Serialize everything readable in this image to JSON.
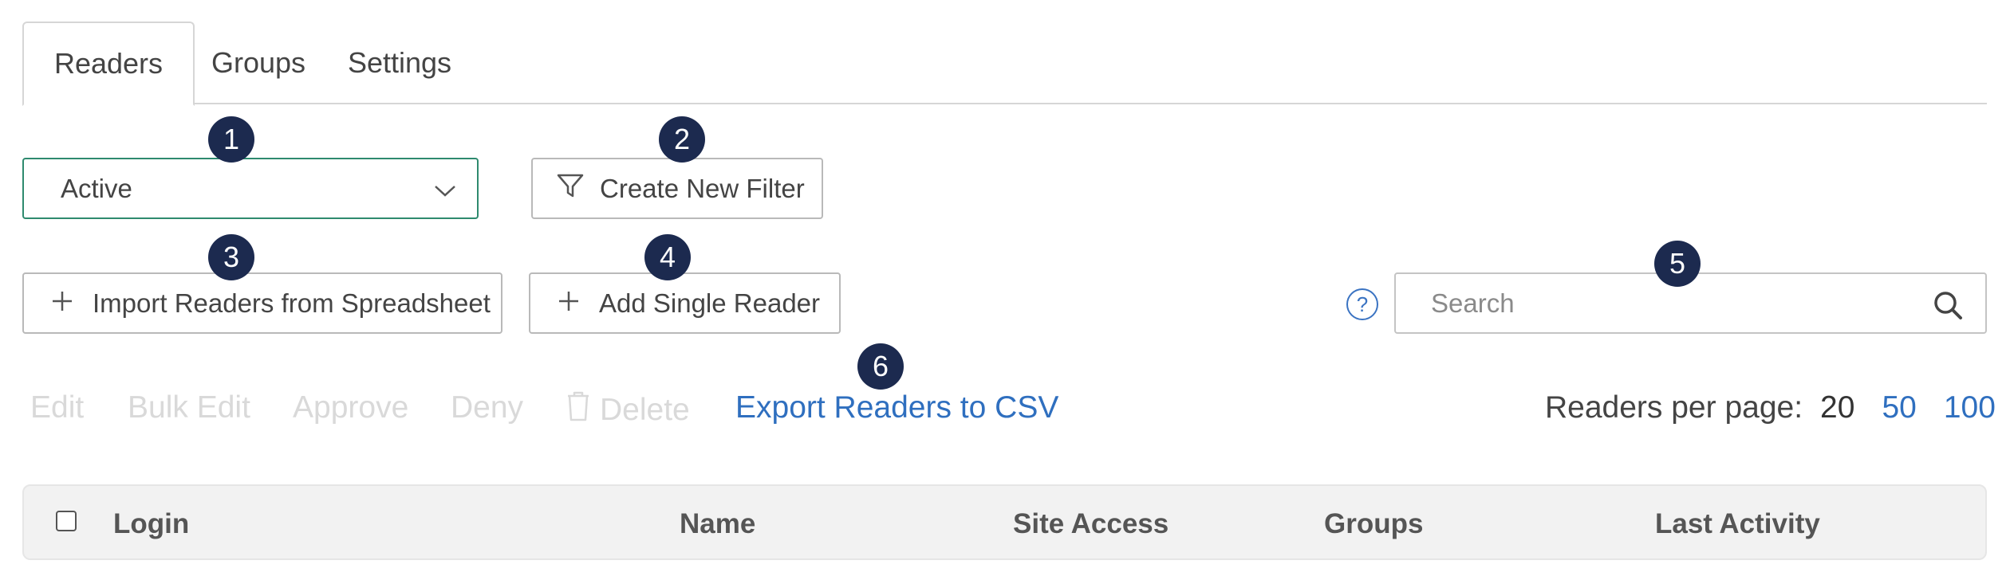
{
  "tabs": [
    {
      "label": "Readers",
      "active": true
    },
    {
      "label": "Groups",
      "active": false
    },
    {
      "label": "Settings",
      "active": false
    }
  ],
  "status_select": {
    "value": "Active",
    "icon": "chevron-down-icon"
  },
  "create_filter": {
    "label": "Create New Filter",
    "icon": "filter-icon"
  },
  "import_button": {
    "label": "Import Readers from Spreadsheet",
    "icon": "plus-icon"
  },
  "add_button": {
    "label": "Add Single Reader",
    "icon": "plus-icon"
  },
  "help": {
    "glyph": "?"
  },
  "search": {
    "placeholder": "Search",
    "value": ""
  },
  "actions": {
    "edit": "Edit",
    "bulk_edit": "Bulk Edit",
    "approve": "Approve",
    "deny": "Deny",
    "delete": "Delete",
    "export": "Export Readers to CSV"
  },
  "per_page": {
    "label": "Readers per page:",
    "options": [
      "20",
      "50",
      "100"
    ],
    "selected": "20"
  },
  "table": {
    "columns": [
      "Login",
      "Name",
      "Site Access",
      "Groups",
      "Last Activity"
    ]
  },
  "callouts": [
    "1",
    "2",
    "3",
    "4",
    "5",
    "6"
  ],
  "colors": {
    "accent_green": "#2e8a6e",
    "link_blue": "#2f6fbf",
    "badge_navy": "#1c2a4f",
    "disabled_text": "#d9d9d9"
  }
}
